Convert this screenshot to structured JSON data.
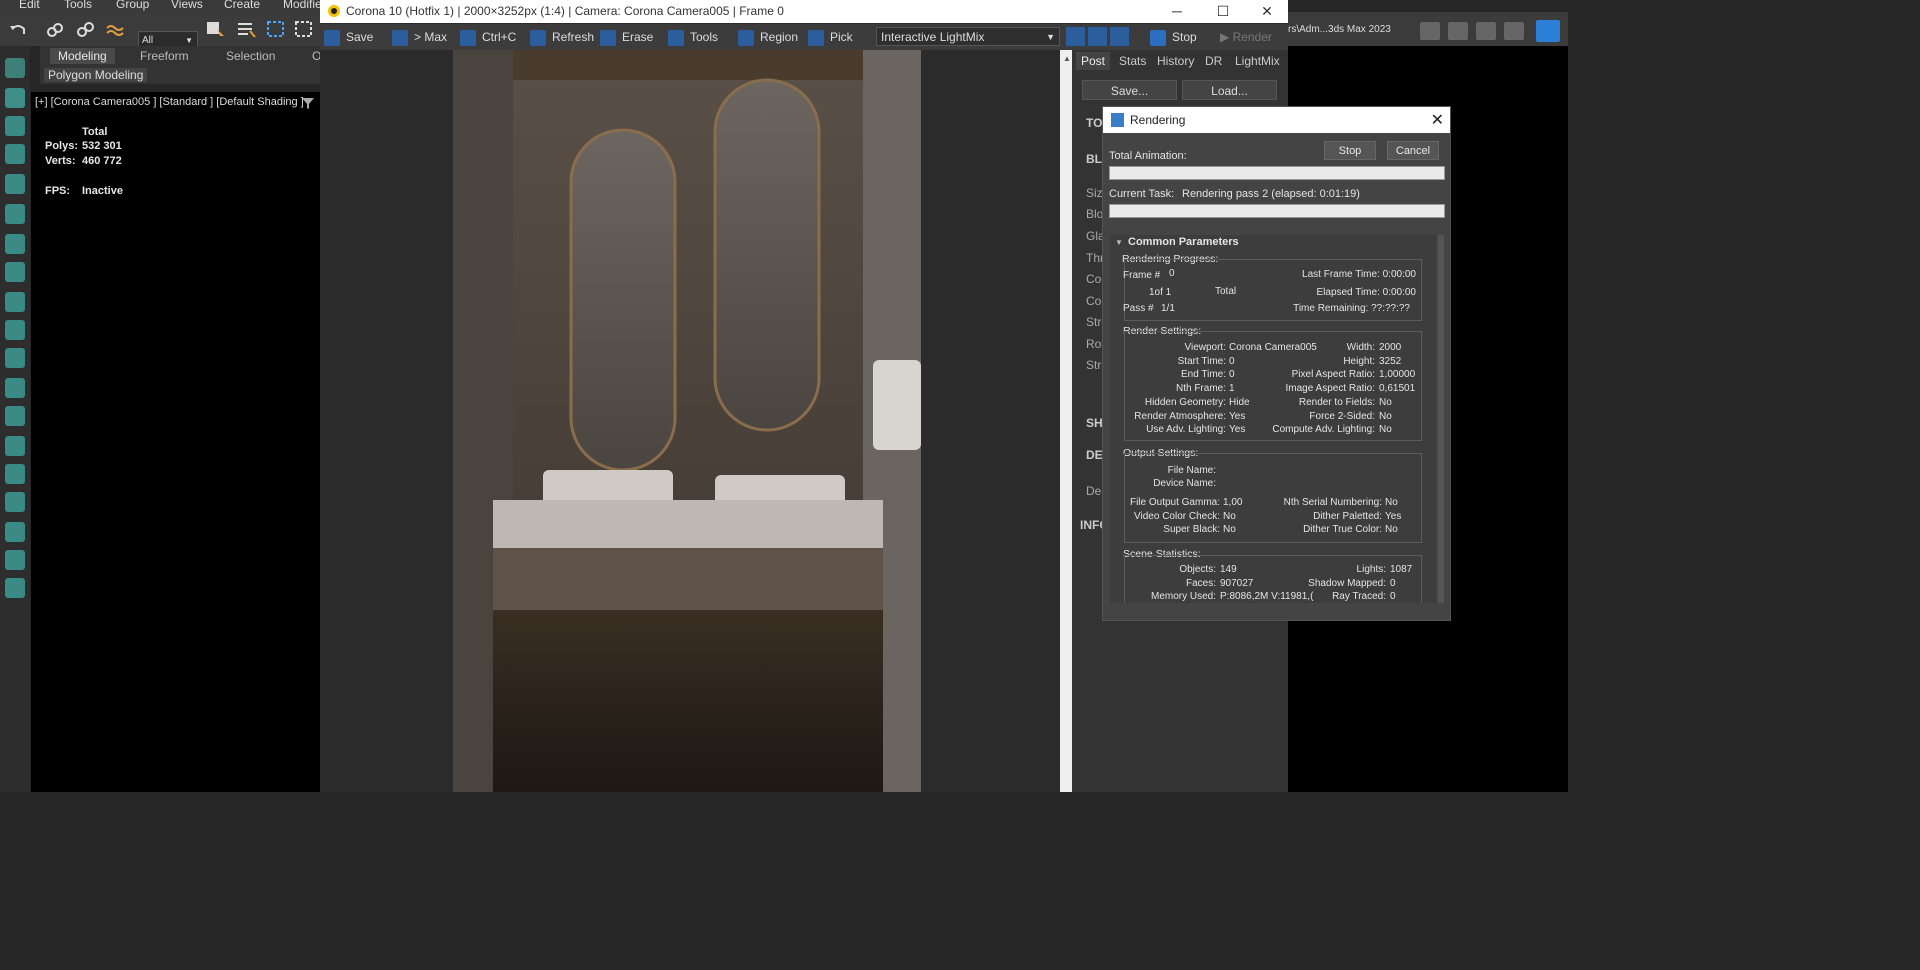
{
  "max": {
    "menu": [
      "Edit",
      "Tools",
      "Group",
      "Views",
      "Create",
      "Modifie"
    ],
    "selection_filter": "All",
    "ribbon_tabs": [
      "Modeling",
      "Freeform",
      "Selection",
      "O"
    ],
    "ribbon_sub": "Polygon Modeling",
    "viewport_label": "[+] [Corona Camera005 ] [Standard ] [Default Shading ]",
    "stats": {
      "header": "Total",
      "polys_label": "Polys:",
      "polys": "532 301",
      "verts_label": "Verts:",
      "verts": "460 772",
      "fps_label": "FPS:",
      "fps": "Inactive"
    },
    "workspace_path": "rs\\Adm...3ds Max 2023"
  },
  "vfb": {
    "title": "Corona 10 (Hotfix 1) | 2000×3252px (1:4) | Camera: Corona Camera005 | Frame 0",
    "toolbar": {
      "save": "Save",
      "to_max": "> Max",
      "copy": "Ctrl+C",
      "refresh": "Refresh",
      "erase": "Erase",
      "tools": "Tools",
      "region": "Region",
      "pick": "Pick",
      "lightmix": "Interactive LightMix",
      "stop": "Stop",
      "render": "Render"
    },
    "panel_tabs": [
      "Post",
      "Stats",
      "History",
      "DR",
      "LightMix"
    ],
    "panel_buttons": {
      "save": "Save...",
      "load": "Load..."
    },
    "side_labels": [
      "TO",
      "BL",
      "Size",
      "Blo",
      "Gla",
      "Thr",
      "Col",
      "Col",
      "Stre",
      "Rot",
      "Stre",
      "SH",
      "DE",
      "Der",
      "INFO"
    ]
  },
  "dialog": {
    "title": "Rendering",
    "stop": "Stop",
    "cancel": "Cancel",
    "total_animation": "Total Animation:",
    "current_task_label": "Current Task:",
    "current_task": "Rendering pass 2 (elapsed: 0:01:19)",
    "rollout_title": "Common Parameters",
    "progress": {
      "header": "Rendering Progress:",
      "frame_label": "Frame #",
      "frame": "0",
      "of": "1of 1",
      "total": "Total",
      "pass_label": "Pass #",
      "pass": "1/1",
      "last_frame_time": "Last Frame Time:  0:00:00",
      "elapsed_time": "Elapsed Time:  0:00:00",
      "time_remaining": "Time Remaining: ??:??:??"
    },
    "render_settings": {
      "header": "Render Settings:",
      "left": [
        [
          "Viewport:",
          "Corona Camera005"
        ],
        [
          "Start Time:",
          "0"
        ],
        [
          "End Time:",
          "0"
        ],
        [
          "Nth Frame:",
          "1"
        ],
        [
          "Hidden Geometry:",
          "Hide"
        ],
        [
          "Render Atmosphere:",
          "Yes"
        ],
        [
          "Use Adv. Lighting:",
          "Yes"
        ]
      ],
      "right": [
        [
          "Width:",
          "2000"
        ],
        [
          "Height:",
          "3252"
        ],
        [
          "Pixel Aspect Ratio:",
          "1,00000"
        ],
        [
          "Image Aspect Ratio:",
          "0,61501"
        ],
        [
          "Render to Fields:",
          "No"
        ],
        [
          "Force 2-Sided:",
          "No"
        ],
        [
          "Compute Adv. Lighting:",
          "No"
        ]
      ]
    },
    "output_settings": {
      "header": "Output Settings:",
      "file_name": "File Name:",
      "device_name": "Device Name:",
      "left": [
        [
          "File Output Gamma:",
          "1,00"
        ],
        [
          "Video Color Check:",
          "No"
        ],
        [
          "Super Black:",
          "No"
        ]
      ],
      "right": [
        [
          "Nth Serial Numbering:",
          "No"
        ],
        [
          "Dither Paletted:",
          "Yes"
        ],
        [
          "Dither True Color:",
          "No"
        ]
      ]
    },
    "scene_stats": {
      "header": "Scene Statistics:",
      "left": [
        [
          "Objects:",
          "149"
        ],
        [
          "Faces:",
          "907027"
        ],
        [
          "Memory Used:",
          "P:8086,2M V:11981,("
        ]
      ],
      "right": [
        [
          "Lights:",
          "1087"
        ],
        [
          "Shadow Mapped:",
          "0"
        ],
        [
          "Ray Traced:",
          "0"
        ]
      ]
    }
  }
}
